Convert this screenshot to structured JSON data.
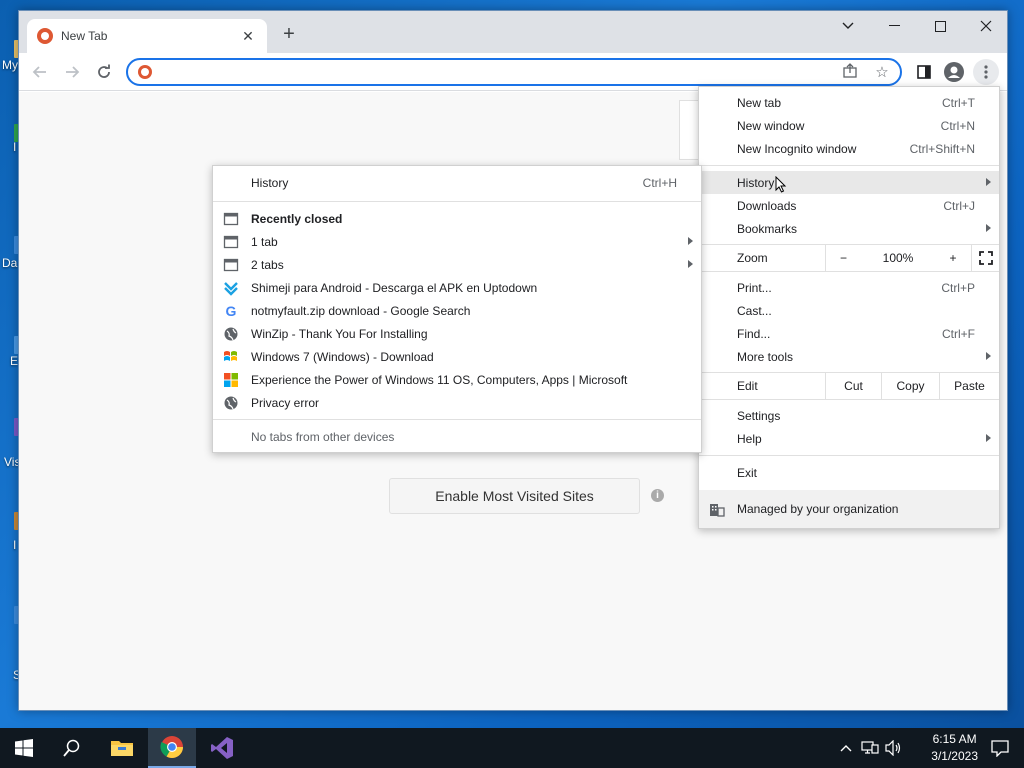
{
  "desktop": {
    "labels": [
      "My",
      "I",
      "Da",
      "E",
      "Vis",
      "I",
      "S"
    ]
  },
  "browser": {
    "tab_title": "New Tab",
    "omnibox_value": "",
    "enable_button": "Enable Most Visited Sites"
  },
  "main_menu": {
    "new_tab": {
      "label": "New tab",
      "shortcut": "Ctrl+T"
    },
    "new_window": {
      "label": "New window",
      "shortcut": "Ctrl+N"
    },
    "incognito": {
      "label": "New Incognito window",
      "shortcut": "Ctrl+Shift+N"
    },
    "history": {
      "label": "History"
    },
    "downloads": {
      "label": "Downloads",
      "shortcut": "Ctrl+J"
    },
    "bookmarks": {
      "label": "Bookmarks"
    },
    "zoom": {
      "label": "Zoom",
      "minus": "−",
      "value": "100%",
      "plus": "+"
    },
    "print": {
      "label": "Print...",
      "shortcut": "Ctrl+P"
    },
    "cast": {
      "label": "Cast..."
    },
    "find": {
      "label": "Find...",
      "shortcut": "Ctrl+F"
    },
    "more_tools": {
      "label": "More tools"
    },
    "edit": {
      "label": "Edit",
      "cut": "Cut",
      "copy": "Copy",
      "paste": "Paste"
    },
    "settings": {
      "label": "Settings"
    },
    "help": {
      "label": "Help"
    },
    "exit": {
      "label": "Exit"
    },
    "managed": {
      "label": "Managed by your organization"
    }
  },
  "history_menu": {
    "history": {
      "label": "History",
      "shortcut": "Ctrl+H"
    },
    "recently_closed": "Recently closed",
    "items": [
      {
        "label": "1 tab",
        "icon": "window-icon",
        "submenu": true
      },
      {
        "label": "2 tabs",
        "icon": "window-icon",
        "submenu": true
      },
      {
        "label": "Shimeji para Android - Descarga el APK en Uptodown",
        "icon": "uptodown-icon",
        "submenu": false
      },
      {
        "label": "notmyfault.zip download - Google Search",
        "icon": "google-icon",
        "submenu": false
      },
      {
        "label": "WinZip - Thank You For Installing",
        "icon": "globe-icon",
        "submenu": false
      },
      {
        "label": "Windows 7 (Windows) - Download",
        "icon": "windows7-icon",
        "submenu": false
      },
      {
        "label": "Experience the Power of Windows 11 OS, Computers,  Apps | Microsoft",
        "icon": "microsoft-icon",
        "submenu": false
      },
      {
        "label": "Privacy error",
        "icon": "globe-icon",
        "submenu": false
      }
    ],
    "no_tabs": "No tabs from other devices"
  },
  "taskbar": {
    "time": "6:15 AM",
    "date": "3/1/2023"
  }
}
